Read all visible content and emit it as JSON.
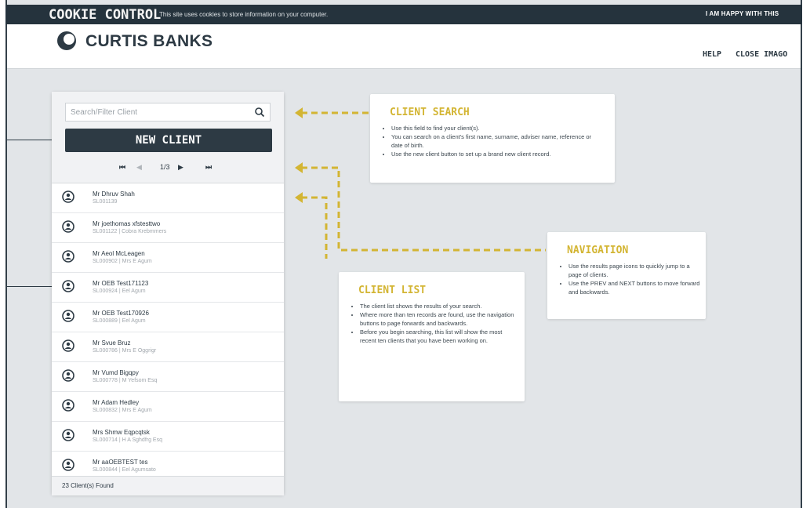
{
  "cookie_bar": {
    "title": "COOKIE CONTROL",
    "message": "This site uses cookies to store information on your computer.",
    "accept_label": "I AM HAPPY WITH THIS"
  },
  "header": {
    "brand": "CURTIS BANKS",
    "help_label": "HELP",
    "close_label": "CLOSE IMAGO"
  },
  "client_panel": {
    "search_placeholder": "Search/Filter Client",
    "new_client_label": "NEW CLIENT",
    "pager": {
      "first": "⏮",
      "prev": "◀",
      "page": "1/3",
      "next": "▶",
      "last": "⏭"
    },
    "clients": [
      {
        "name": "Mr Dhruv Shah",
        "sub": "SL001139"
      },
      {
        "name": "Mr joethomas xfstesttwo",
        "sub": "SL001122 | Cobra Krebmmers"
      },
      {
        "name": "Mr Aeol McLeagen",
        "sub": "SL000902 | Mrs E Agum"
      },
      {
        "name": "Mr OEB Test171123",
        "sub": "SL000924 | Eel Agum"
      },
      {
        "name": "Mr OEB Test170926",
        "sub": "SL000889 | Eel Agum"
      },
      {
        "name": "Mr Svue Bruz",
        "sub": "SL000786 | Mrs E Oggrigr"
      },
      {
        "name": "Mr Vumd Bigqpy",
        "sub": "SL000778 | M Yefsom Esq"
      },
      {
        "name": "Mr Adam Hedley",
        "sub": "SL000832 | Mrs E Agum"
      },
      {
        "name": "Mrs Shmw Eqpcqtsk",
        "sub": "SL000714 | H A Sghdfrg Esq"
      },
      {
        "name": "Mr aaOEBTEST tes",
        "sub": "SL000844 | Eel Agumsato"
      }
    ],
    "found_text": "23  Client(s) Found"
  },
  "cards": {
    "client_search": {
      "title": "CLIENT SEARCH",
      "bullets": [
        "Use this field to find your client(s).",
        "You can search on a client's first name, surname, adviser name, reference or date of birth.",
        "Use the new client button to set up a brand new client record."
      ]
    },
    "navigation": {
      "title": "NAVIGATION",
      "bullets": [
        "Use the results page icons to quickly jump to a page of clients.",
        "Use the PREV and NEXT buttons to move forward and backwards."
      ]
    },
    "client_list": {
      "title": "CLIENT LIST",
      "bullets": [
        "The client list shows the results of your search.",
        "Where more than ten records are found, use the navigation buttons to page forwards and backwards.",
        "Before you begin searching, this list will show the most recent ten clients that you have been working on."
      ]
    }
  },
  "colors": {
    "dark": "#2d3a44",
    "accent_yellow": "#d3b533",
    "background": "#e2e5e8"
  }
}
